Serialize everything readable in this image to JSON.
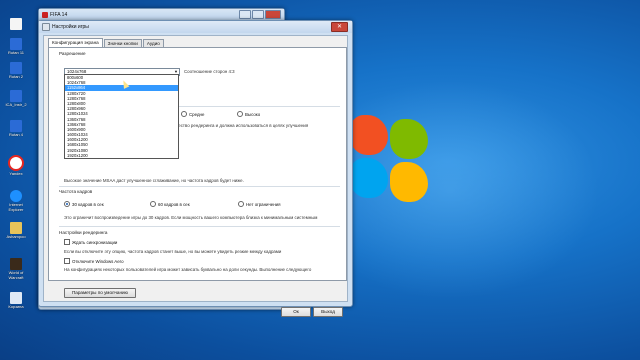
{
  "desktop_icons": [
    {
      "label": ""
    },
    {
      "label": "Rutan 11"
    },
    {
      "label": "Rutan 2"
    },
    {
      "label": "ICA_Instr_2"
    },
    {
      "label": "Rutan 4"
    },
    {
      "label": "Yandex"
    },
    {
      "label": "Internet Explorer"
    },
    {
      "label": "Ashampoo"
    },
    {
      "label": "World of Warcraft"
    },
    {
      "label": "Корзина"
    }
  ],
  "back_window": {
    "title": "FIFA 14"
  },
  "dialog": {
    "title": "Настройки игры",
    "tabs": [
      "Конфигурация экрана",
      "Значки кнопки",
      "Аудио"
    ],
    "resolution_label": "Разрешение",
    "resolution_value": "1024x768",
    "aspect_label": "Соотношение сторон 4:3",
    "resolution_options": [
      "800x600",
      "1024x768",
      "1152x864",
      "1280x720",
      "1280x768",
      "1280x800",
      "1280x960",
      "1280x1024",
      "1360x768",
      "1366x768",
      "1600x900",
      "1600x1024",
      "1600x1200",
      "1680x1050",
      "1920x1080",
      "1920x1200"
    ],
    "selected_index": 2,
    "quality_medium": "Средне",
    "quality_high": "Высоко",
    "quality_desc": "чество рендеринга и должна использоваться в целях улучшения",
    "msaa_desc": "Высокое значение MSAA даст улучшенное сглаживание, но частота кадров будет ниже.",
    "fps_label": "Частота кадров",
    "fps_options": [
      "30 кадров в сек",
      "60 кадров в сек",
      "Нет ограничения"
    ],
    "fps_desc": "Это ограничит воспроизведение игры до 30 кадров. Если мощность вашего компьютера близка к минимальным системным",
    "render_label": "Настройки рендеринга",
    "vsync_label": "Ждать синхронизации",
    "vsync_desc": "Если вы отключите эту опцию, частота кадров станет выше, но вы можете увидеть резкие между кадрами",
    "aero_label": "Отключите Windows Aero",
    "aero_desc": "На конфигурациях некоторых пользователей игра может зависать буквально на доли секунды. Выполнение следующего",
    "defaults_button": "Параметры по умолчанию",
    "ok_button": "Ок",
    "cancel_button": "Выход"
  }
}
